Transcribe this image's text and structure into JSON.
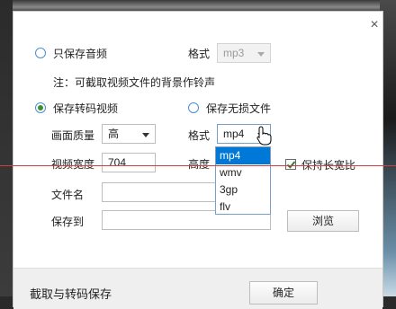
{
  "dialog": {
    "close_glyph": "×",
    "audio_only": {
      "label": "只保存音频",
      "format_label": "格式",
      "format_value": "mp3"
    },
    "note": "注：可截取视频文件的背景作铃声",
    "transcode": {
      "label": "保存转码视频",
      "quality_label": "画面质量",
      "quality_value": "高",
      "width_label": "视频宽度",
      "width_value": "704",
      "height_label": "高度"
    },
    "lossless": {
      "label": "保存无损文件",
      "format_label": "格式",
      "format_value": "mp4",
      "options": [
        "mp4",
        "wmv",
        "3gp",
        "flv"
      ]
    },
    "keep_ratio_label": "保持长宽比",
    "filename_label": "文件名",
    "filename_value": "",
    "saveto_label": "保存到",
    "saveto_value": "",
    "browse_label": "浏览",
    "footer_title": "截取与转码保存",
    "confirm_label": "确定"
  },
  "colors": {
    "accent": "#0078d7",
    "radio_checked": "#3c8f2f",
    "guide_line": "#d04040"
  }
}
